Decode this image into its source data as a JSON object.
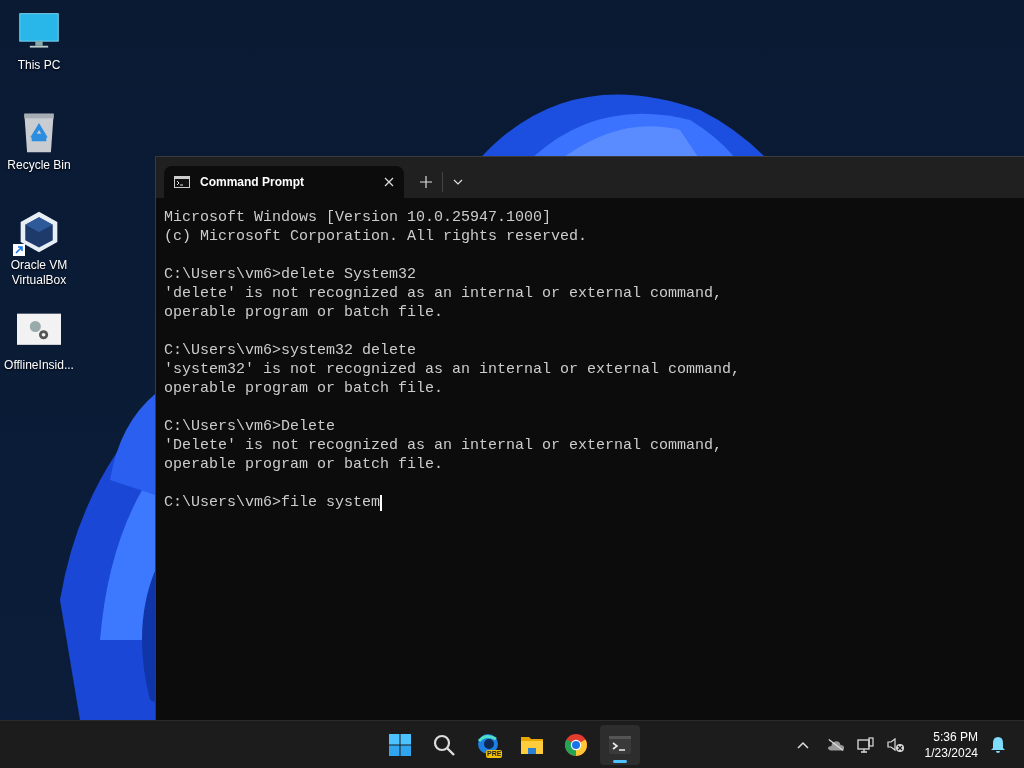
{
  "desktop_icons": [
    {
      "kind": "monitor",
      "label": "This PC"
    },
    {
      "kind": "recycle",
      "label": "Recycle Bin"
    },
    {
      "kind": "cube",
      "label": "Oracle VM VirtualBox",
      "shortcut": true
    },
    {
      "kind": "gears",
      "label": "OfflineInsid..."
    }
  ],
  "terminal": {
    "tabs": [
      {
        "title": "Command Prompt",
        "selected": true
      }
    ],
    "blocks": [
      {
        "lines": [
          "Microsoft Windows [Version 10.0.25947.1000]",
          "(c) Microsoft Corporation. All rights reserved."
        ]
      },
      {
        "lines": [
          "C:\\Users\\vm6>delete System32",
          "'delete' is not recognized as an internal or external command,",
          "operable program or batch file."
        ]
      },
      {
        "lines": [
          "C:\\Users\\vm6>system32 delete",
          "'system32' is not recognized as an internal or external command,",
          "operable program or batch file."
        ]
      },
      {
        "lines": [
          "C:\\Users\\vm6>Delete",
          "'Delete' is not recognized as an internal or external command,",
          "operable program or batch file."
        ]
      },
      {
        "lines": [
          "C:\\Users\\vm6>file system"
        ],
        "cursor": true
      }
    ]
  },
  "taskbar": {
    "apps": [
      {
        "kind": "start",
        "active": false
      },
      {
        "kind": "search",
        "active": false
      },
      {
        "kind": "edge",
        "badge": "PRE",
        "active": false
      },
      {
        "kind": "folder",
        "active": false
      },
      {
        "kind": "chrome",
        "active": false
      },
      {
        "kind": "terminal",
        "active": true
      }
    ],
    "tray": {
      "time": "5:36 PM",
      "date": "1/23/2024"
    }
  }
}
